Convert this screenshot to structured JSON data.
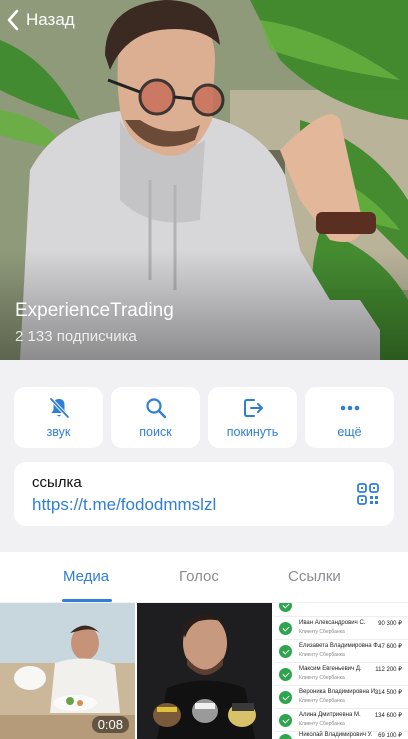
{
  "header": {
    "back_label": "Назад",
    "channel_name": "ExperienceTrading",
    "subscribers": "2 133 подписчика"
  },
  "actions": [
    {
      "label": "звук",
      "icon": "bell-slash-icon"
    },
    {
      "label": "поиск",
      "icon": "search-icon"
    },
    {
      "label": "покинуть",
      "icon": "leave-icon"
    },
    {
      "label": "ещё",
      "icon": "more-icon"
    }
  ],
  "link": {
    "title": "ссылка",
    "url": "https://t.me/fododmmslzl",
    "icon": "qr-code-icon"
  },
  "tabs": [
    {
      "label": "Медиа",
      "active": true
    },
    {
      "label": "Голос",
      "active": false
    },
    {
      "label": "Ссылки",
      "active": false
    }
  ],
  "media": {
    "video_duration": "0:08",
    "transfers": [
      {
        "name": "",
        "sub": "",
        "amount": ""
      },
      {
        "name": "Иван Александрович С.",
        "sub": "Клиенту Сбербанка",
        "amount": "90 300 ₽"
      },
      {
        "name": "Елизавета Владимировна Ф.",
        "sub": "Клиенту Сбербанка",
        "amount": "47 600 ₽"
      },
      {
        "name": "Максим Евгеньевич Д.",
        "sub": "Клиенту Сбербанка",
        "amount": "112 200 ₽"
      },
      {
        "name": "Вероника Владимировна И.",
        "sub": "Клиенту Сбербанка",
        "amount": "314 500 ₽"
      },
      {
        "name": "Алина Дмитриевна М.",
        "sub": "Клиенту Сбербанка",
        "amount": "134 600 ₽"
      },
      {
        "name": "Николай Владимирович У.",
        "sub": "Клиенту Сбербанка",
        "amount": "69 100 ₽"
      }
    ]
  },
  "colors": {
    "accent": "#2f7fd6",
    "background": "#f1f1f4",
    "card": "#ffffff"
  }
}
